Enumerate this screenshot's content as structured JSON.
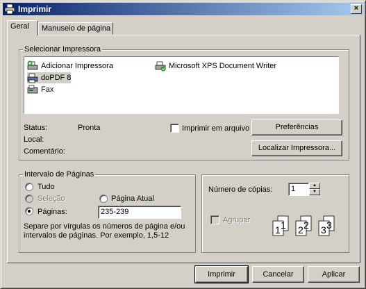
{
  "window": {
    "title": "Imprimir",
    "close_symbol": "×"
  },
  "tabs": [
    {
      "label": "Geral"
    },
    {
      "label": "Manuseio de página"
    }
  ],
  "select_printer": {
    "legend": "Selecionar Impressora",
    "printers": [
      {
        "label": "Adicionar Impressora",
        "icon": "add-printer-icon"
      },
      {
        "label": "Microsoft XPS Document Writer",
        "icon": "printer-ready-icon"
      },
      {
        "label": "doPDF 8",
        "icon": "printer-icon",
        "selected": true
      },
      {
        "label": "Fax",
        "icon": "fax-icon"
      }
    ],
    "status_label": "Status:",
    "status_value": "Pronta",
    "location_label": "Local:",
    "comment_label": "Comentário:",
    "print_to_file_label": "Imprimir em arquivo",
    "preferences_button": "Preferências",
    "find_printer_button": "Localizar Impressora..."
  },
  "page_range": {
    "legend": "Intervalo de Páginas",
    "all_label": "Tudo",
    "selection_label": "Seleção",
    "current_page_label": "Página Atual",
    "pages_label": "Páginas:",
    "pages_value": "235-239",
    "hint_line1": "Separe por vírgulas os números de página e/ou",
    "hint_line2": "intervalos de páginas. Por exemplo, 1,5-12"
  },
  "copies": {
    "label": "Número de cópias:",
    "value": "1",
    "collate_label": "Agrupar",
    "collate_digits": [
      "1",
      "1",
      "2",
      "2",
      "3",
      "3"
    ]
  },
  "footer": {
    "print_button": "Imprimir",
    "cancel_button": "Cancelar",
    "apply_button": "Aplicar"
  },
  "colors": {
    "title_gradient_start": "#0a246a",
    "title_gradient_end": "#a6caf0",
    "face": "#d4d0c8"
  }
}
